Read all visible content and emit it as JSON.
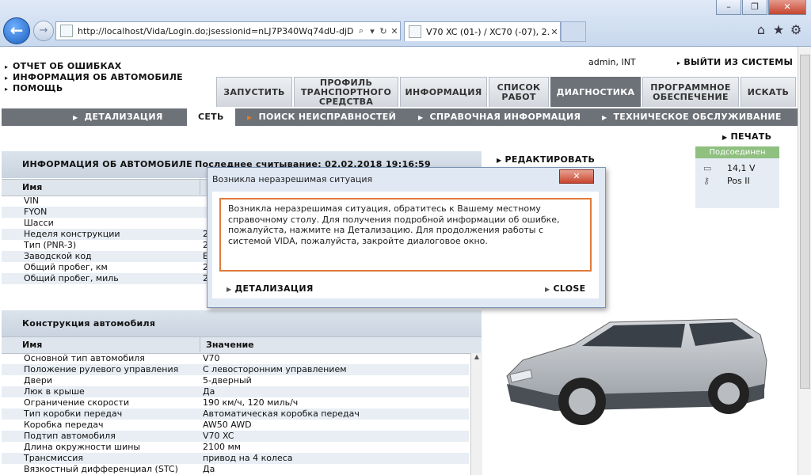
{
  "browser": {
    "window_controls": {
      "minimize": "–",
      "maximize": "❐",
      "close": "✕"
    },
    "address": "http://localhost/Vida/Login.do;jsessionid=nLJ7P340Wq74dU-djD",
    "tab_title": "V70 XC (01-) / XC70 (-07), 2...",
    "tab_close": "✕"
  },
  "top_links": [
    "ОТЧЕТ ОБ ОШИБКАХ",
    "ИНФОРМАЦИЯ ОБ АВТОМОБИЛЕ",
    "ПОМОЩЬ"
  ],
  "user": {
    "info": "admin, INT",
    "logout": "ВЫЙТИ ИЗ СИСТЕМЫ"
  },
  "main_tabs": [
    {
      "label": "ЗАПУСТИТЬ"
    },
    {
      "label": "ПРОФИЛЬ ТРАНСПОРТНОГО СРЕДСТВА"
    },
    {
      "label": "ИНФОРМАЦИЯ"
    },
    {
      "label": "СПИСОК РАБОТ"
    },
    {
      "label": "ДИАГНОСТИКА"
    },
    {
      "label": "ПРОГРАММНОЕ ОБЕСПЕЧЕНИЕ"
    },
    {
      "label": "ИСКАТЬ"
    }
  ],
  "sub_nav": [
    {
      "label": "ДЕТАЛИЗАЦИЯ"
    },
    {
      "label": "СЕТЬ"
    },
    {
      "label": "ПОИСК НЕИСПРАВНОСТЕЙ"
    },
    {
      "label": "СПРАВОЧНАЯ ИНФОРМАЦИЯ"
    },
    {
      "label": "ТЕХНИЧЕСКОЕ ОБСЛУЖИВАНИЕ"
    }
  ],
  "vehicle_info": {
    "title": "ИНФОРМАЦИЯ ОБ АВТОМОБИЛЕ",
    "last_read": "Последнее считывание: 02.02.2018 19:16:59",
    "col_name": "Имя",
    "rows": [
      {
        "name": "VIN",
        "value": ""
      },
      {
        "name": "FYON",
        "value": ""
      },
      {
        "name": "Шасси",
        "value": ""
      },
      {
        "name": "Неделя конструкции",
        "value": "2"
      },
      {
        "name": "Тип (PNR-3)",
        "value": "2"
      },
      {
        "name": "Заводской код",
        "value": "Е"
      },
      {
        "name": "Общий пробег, км",
        "value": "2"
      },
      {
        "name": "Общий пробег, миль",
        "value": "2"
      }
    ]
  },
  "construction": {
    "title": "Конструкция автомобиля",
    "col_name": "Имя",
    "col_value": "Значение",
    "rows": [
      {
        "name": "Основной тип автомобиля",
        "value": "V70"
      },
      {
        "name": "Положение рулевого управления",
        "value": "С левосторонним управлением"
      },
      {
        "name": "Двери",
        "value": "5-дверный"
      },
      {
        "name": "Люк в крыше",
        "value": "Да"
      },
      {
        "name": "Ограничение скорости",
        "value": "190 км/ч, 120 миль/ч"
      },
      {
        "name": "Тип коробки передач",
        "value": "Автоматическая коробка передач"
      },
      {
        "name": "Коробка передач",
        "value": "AW50 AWD"
      },
      {
        "name": "Подтип автомобиля",
        "value": "V70 XC"
      },
      {
        "name": "Длина окружности шины",
        "value": "2100 мм"
      },
      {
        "name": "Трансмиссия",
        "value": "привод на 4 колеса"
      },
      {
        "name": "Вязкостный дифференциал (STC)",
        "value": "Да"
      }
    ]
  },
  "edit_label": "РЕДАКТИРОВАТЬ",
  "print_label": "ПЕЧАТЬ",
  "connection": {
    "status": "Подсоединен",
    "voltage": "14,1 V",
    "ignition": "Pos II"
  },
  "dialog": {
    "title": "Возникла неразрешимая ситуация",
    "close_x": "✕",
    "message": "Возникла неразрешимая ситуация, обратитесь к Вашему местному справочному столу. Для получения подробной информации об ошибке, пожалуйста, нажмите на Детализацию. Для продолжения работы с системой VIDA, пожалуйста, закройте диалоговое окно.",
    "details_button": "ДЕТАЛИЗАЦИЯ",
    "close_button": "CLOSE"
  },
  "colors": {
    "active_tab": "#6d7178",
    "accent_orange": "#e07a3a",
    "connected_green": "#8fc080"
  }
}
